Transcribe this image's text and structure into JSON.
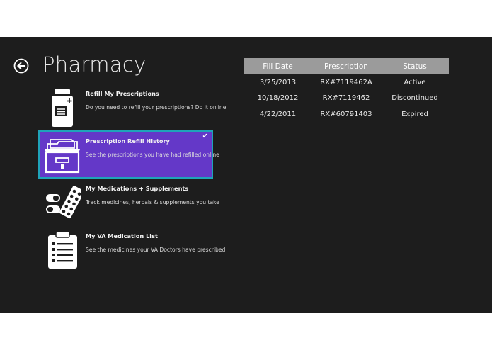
{
  "header": {
    "title": "Pharmacy"
  },
  "tiles": [
    {
      "title": "Refill My Prescriptions",
      "desc": "Do you need to refill your prescriptions? Do it online",
      "icon": "pill-bottle-icon"
    },
    {
      "title": "Prescription Refill History",
      "desc": "See the prescriptions you have had refilled online",
      "icon": "file-drawer-icon",
      "selected": true,
      "check": "✔"
    },
    {
      "title": "My Medications + Supplements",
      "desc": "Track medicines, herbals & supplements you take",
      "icon": "pills-icon"
    },
    {
      "title": "My VA Medication List",
      "desc": "See the medicines your VA Doctors have prescribed",
      "icon": "clipboard-list-icon"
    }
  ],
  "table": {
    "headers": [
      "Fill Date",
      "Prescription",
      "Status"
    ],
    "rows": [
      [
        "3/25/2013",
        "RX#7119462A",
        "Active"
      ],
      [
        "10/18/2012",
        "RX#7119462",
        "Discontinued"
      ],
      [
        "4/22/2011",
        "RX#60791403",
        "Expired"
      ]
    ],
    "header_bg": "#9b9b9b"
  },
  "colors": {
    "background": "#1d1d1d",
    "selected_tile": "#6438c8",
    "selected_border": "#1fa3b9"
  }
}
